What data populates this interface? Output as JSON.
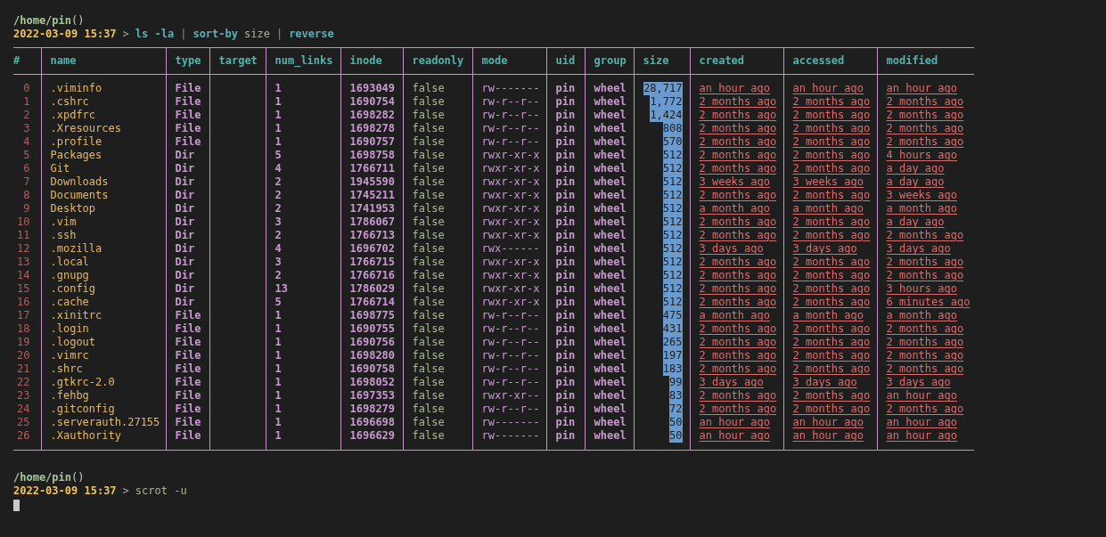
{
  "prompts": [
    {
      "path": "/home/pin",
      "paren": "()",
      "timestamp": "2022-03-09 15:37",
      "symbol": ">",
      "tokens": [
        {
          "text": "ls -la",
          "kind": "command"
        },
        {
          "text": "|",
          "kind": "pipe"
        },
        {
          "text": "sort-by",
          "kind": "command"
        },
        {
          "text": "size",
          "kind": "arg"
        },
        {
          "text": "|",
          "kind": "pipe"
        },
        {
          "text": "reverse",
          "kind": "command"
        }
      ]
    }
  ],
  "table": {
    "size_highlighted": true,
    "columns": [
      "#",
      "name",
      "type",
      "target",
      "num_links",
      "inode",
      "readonly",
      "mode",
      "uid",
      "group",
      "size",
      "created",
      "accessed",
      "modified"
    ],
    "rows": [
      {
        "index": "0",
        "name": ".viminfo",
        "type": "File",
        "num_links": "1",
        "inode": "1693049",
        "readonly": "false",
        "mode": "rw-------",
        "uid": "pin",
        "group": "wheel",
        "size": "28,717",
        "created": "an hour ago",
        "accessed": "an hour ago",
        "modified": "an hour ago"
      },
      {
        "index": "1",
        "name": ".cshrc",
        "type": "File",
        "num_links": "1",
        "inode": "1690754",
        "readonly": "false",
        "mode": "rw-r--r--",
        "uid": "pin",
        "group": "wheel",
        "size": "1,772",
        "created": "2 months ago",
        "accessed": "2 months ago",
        "modified": "2 months ago"
      },
      {
        "index": "2",
        "name": ".xpdfrc",
        "type": "File",
        "num_links": "1",
        "inode": "1698282",
        "readonly": "false",
        "mode": "rw-r--r--",
        "uid": "pin",
        "group": "wheel",
        "size": "1,424",
        "created": "2 months ago",
        "accessed": "2 months ago",
        "modified": "2 months ago"
      },
      {
        "index": "3",
        "name": ".Xresources",
        "type": "File",
        "num_links": "1",
        "inode": "1698278",
        "readonly": "false",
        "mode": "rw-r--r--",
        "uid": "pin",
        "group": "wheel",
        "size": "808",
        "created": "2 months ago",
        "accessed": "2 months ago",
        "modified": "2 months ago"
      },
      {
        "index": "4",
        "name": ".profile",
        "type": "File",
        "num_links": "1",
        "inode": "1690757",
        "readonly": "false",
        "mode": "rw-r--r--",
        "uid": "pin",
        "group": "wheel",
        "size": "570",
        "created": "2 months ago",
        "accessed": "2 months ago",
        "modified": "2 months ago"
      },
      {
        "index": "5",
        "name": "Packages",
        "type": "Dir",
        "num_links": "5",
        "inode": "1698758",
        "readonly": "false",
        "mode": "rwxr-xr-x",
        "uid": "pin",
        "group": "wheel",
        "size": "512",
        "created": "2 months ago",
        "accessed": "2 months ago",
        "modified": "4 hours ago"
      },
      {
        "index": "6",
        "name": "Git",
        "type": "Dir",
        "num_links": "4",
        "inode": "1766711",
        "readonly": "false",
        "mode": "rwxr-xr-x",
        "uid": "pin",
        "group": "wheel",
        "size": "512",
        "created": "2 months ago",
        "accessed": "2 months ago",
        "modified": "a day ago"
      },
      {
        "index": "7",
        "name": "Downloads",
        "type": "Dir",
        "num_links": "2",
        "inode": "1945590",
        "readonly": "false",
        "mode": "rwxr-xr-x",
        "uid": "pin",
        "group": "wheel",
        "size": "512",
        "created": "3 weeks ago",
        "accessed": "3 weeks ago",
        "modified": "a day ago"
      },
      {
        "index": "8",
        "name": "Documents",
        "type": "Dir",
        "num_links": "2",
        "inode": "1745211",
        "readonly": "false",
        "mode": "rwxr-xr-x",
        "uid": "pin",
        "group": "wheel",
        "size": "512",
        "created": "2 months ago",
        "accessed": "2 months ago",
        "modified": "3 weeks ago"
      },
      {
        "index": "9",
        "name": "Desktop",
        "type": "Dir",
        "num_links": "2",
        "inode": "1741953",
        "readonly": "false",
        "mode": "rwxr-xr-x",
        "uid": "pin",
        "group": "wheel",
        "size": "512",
        "created": "a month ago",
        "accessed": "a month ago",
        "modified": "a month ago"
      },
      {
        "index": "10",
        "name": ".vim",
        "type": "Dir",
        "num_links": "3",
        "inode": "1786067",
        "readonly": "false",
        "mode": "rwxr-xr-x",
        "uid": "pin",
        "group": "wheel",
        "size": "512",
        "created": "2 months ago",
        "accessed": "2 months ago",
        "modified": "a day ago"
      },
      {
        "index": "11",
        "name": ".ssh",
        "type": "Dir",
        "num_links": "2",
        "inode": "1766713",
        "readonly": "false",
        "mode": "rwxr-xr-x",
        "uid": "pin",
        "group": "wheel",
        "size": "512",
        "created": "2 months ago",
        "accessed": "2 months ago",
        "modified": "2 months ago"
      },
      {
        "index": "12",
        "name": ".mozilla",
        "type": "Dir",
        "num_links": "4",
        "inode": "1696702",
        "readonly": "false",
        "mode": "rwx------",
        "uid": "pin",
        "group": "wheel",
        "size": "512",
        "created": "3 days ago",
        "accessed": "3 days ago",
        "modified": "3 days ago"
      },
      {
        "index": "13",
        "name": ".local",
        "type": "Dir",
        "num_links": "3",
        "inode": "1766715",
        "readonly": "false",
        "mode": "rwxr-xr-x",
        "uid": "pin",
        "group": "wheel",
        "size": "512",
        "created": "2 months ago",
        "accessed": "2 months ago",
        "modified": "2 months ago"
      },
      {
        "index": "14",
        "name": ".gnupg",
        "type": "Dir",
        "num_links": "2",
        "inode": "1766716",
        "readonly": "false",
        "mode": "rwxr-xr-x",
        "uid": "pin",
        "group": "wheel",
        "size": "512",
        "created": "2 months ago",
        "accessed": "2 months ago",
        "modified": "2 months ago"
      },
      {
        "index": "15",
        "name": ".config",
        "type": "Dir",
        "num_links": "13",
        "inode": "1786029",
        "readonly": "false",
        "mode": "rwxr-xr-x",
        "uid": "pin",
        "group": "wheel",
        "size": "512",
        "created": "2 months ago",
        "accessed": "2 months ago",
        "modified": "3 hours ago"
      },
      {
        "index": "16",
        "name": ".cache",
        "type": "Dir",
        "num_links": "5",
        "inode": "1766714",
        "readonly": "false",
        "mode": "rwxr-xr-x",
        "uid": "pin",
        "group": "wheel",
        "size": "512",
        "created": "2 months ago",
        "accessed": "2 months ago",
        "modified": "6 minutes ago"
      },
      {
        "index": "17",
        "name": ".xinitrc",
        "type": "File",
        "num_links": "1",
        "inode": "1698775",
        "readonly": "false",
        "mode": "rw-r--r--",
        "uid": "pin",
        "group": "wheel",
        "size": "475",
        "created": "a month ago",
        "accessed": "a month ago",
        "modified": "a month ago"
      },
      {
        "index": "18",
        "name": ".login",
        "type": "File",
        "num_links": "1",
        "inode": "1690755",
        "readonly": "false",
        "mode": "rw-r--r--",
        "uid": "pin",
        "group": "wheel",
        "size": "431",
        "created": "2 months ago",
        "accessed": "2 months ago",
        "modified": "2 months ago"
      },
      {
        "index": "19",
        "name": ".logout",
        "type": "File",
        "num_links": "1",
        "inode": "1690756",
        "readonly": "false",
        "mode": "rw-r--r--",
        "uid": "pin",
        "group": "wheel",
        "size": "265",
        "created": "2 months ago",
        "accessed": "2 months ago",
        "modified": "2 months ago"
      },
      {
        "index": "20",
        "name": ".vimrc",
        "type": "File",
        "num_links": "1",
        "inode": "1698280",
        "readonly": "false",
        "mode": "rw-r--r--",
        "uid": "pin",
        "group": "wheel",
        "size": "197",
        "created": "2 months ago",
        "accessed": "2 months ago",
        "modified": "2 months ago"
      },
      {
        "index": "21",
        "name": ".shrc",
        "type": "File",
        "num_links": "1",
        "inode": "1690758",
        "readonly": "false",
        "mode": "rw-r--r--",
        "uid": "pin",
        "group": "wheel",
        "size": "183",
        "created": "2 months ago",
        "accessed": "2 months ago",
        "modified": "2 months ago"
      },
      {
        "index": "22",
        "name": ".gtkrc-2.0",
        "type": "File",
        "num_links": "1",
        "inode": "1698052",
        "readonly": "false",
        "mode": "rw-r--r--",
        "uid": "pin",
        "group": "wheel",
        "size": "99",
        "created": "3 days ago",
        "accessed": "3 days ago",
        "modified": "3 days ago"
      },
      {
        "index": "23",
        "name": ".fehbg",
        "type": "File",
        "num_links": "1",
        "inode": "1697353",
        "readonly": "false",
        "mode": "rwxr-xr--",
        "uid": "pin",
        "group": "wheel",
        "size": "83",
        "created": "2 months ago",
        "accessed": "2 months ago",
        "modified": "an hour ago"
      },
      {
        "index": "24",
        "name": ".gitconfig",
        "type": "File",
        "num_links": "1",
        "inode": "1698279",
        "readonly": "false",
        "mode": "rw-r--r--",
        "uid": "pin",
        "group": "wheel",
        "size": "72",
        "created": "2 months ago",
        "accessed": "2 months ago",
        "modified": "2 months ago"
      },
      {
        "index": "25",
        "name": ".serverauth.27155",
        "type": "File",
        "num_links": "1",
        "inode": "1696698",
        "readonly": "false",
        "mode": "rw-------",
        "uid": "pin",
        "group": "wheel",
        "size": "50",
        "created": "an hour ago",
        "accessed": "an hour ago",
        "modified": "an hour ago"
      },
      {
        "index": "26",
        "name": ".Xauthority",
        "type": "File",
        "num_links": "1",
        "inode": "1696629",
        "readonly": "false",
        "mode": "rw-------",
        "uid": "pin",
        "group": "wheel",
        "size": "50",
        "created": "an hour ago",
        "accessed": "an hour ago",
        "modified": "an hour ago"
      }
    ]
  },
  "final_prompt": {
    "path": "/home/pin",
    "paren": "()",
    "timestamp": "2022-03-09 15:37",
    "symbol": ">",
    "tokens": [
      {
        "text": "scrot -u",
        "kind": "arg"
      }
    ],
    "cursor": true
  }
}
